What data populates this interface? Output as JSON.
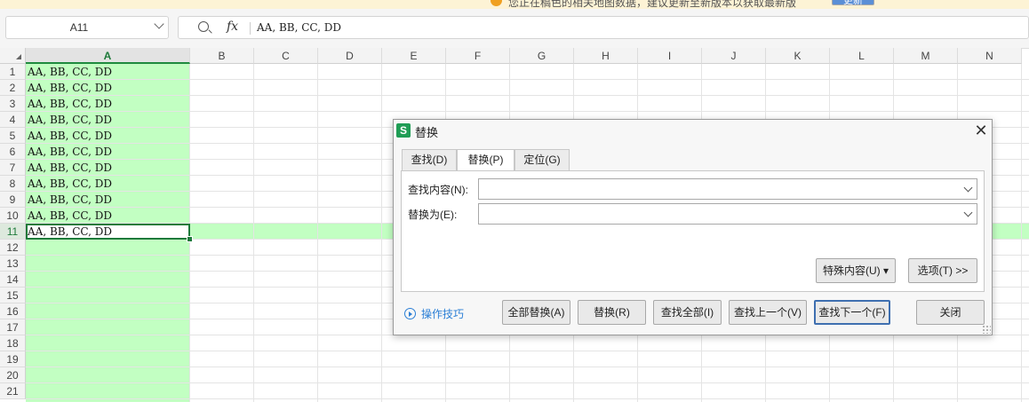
{
  "notice": {
    "text": "您正在稿色的相关地图数据，建议更新至新版本以获取最新版",
    "button": "更新"
  },
  "formula_bar": {
    "name_box": "A11",
    "fx_symbol": "fx",
    "content": "AA, BB, CC, DD"
  },
  "grid": {
    "columns": [
      "A",
      "B",
      "C",
      "D",
      "E",
      "F",
      "G",
      "H",
      "I",
      "J",
      "K",
      "L",
      "M",
      "N"
    ],
    "rows": [
      "1",
      "2",
      "3",
      "4",
      "5",
      "6",
      "7",
      "8",
      "9",
      "10",
      "11",
      "12",
      "13",
      "14",
      "15",
      "16",
      "17",
      "18",
      "19",
      "20",
      "21"
    ],
    "cells_A": [
      "AA, BB, CC, DD",
      "AA, BB, CC, DD",
      "AA, BB, CC, DD",
      "AA, BB, CC, DD",
      "AA, BB, CC, DD",
      "AA, BB, CC, DD",
      "AA, BB, CC, DD",
      "AA, BB, CC, DD",
      "AA, BB, CC, DD",
      "AA, BB, CC, DD",
      "AA, BB, CC, DD"
    ],
    "highlight_color": "#c2ffc2",
    "active_border_color": "#1e7a3a"
  },
  "dialog": {
    "logo": "S",
    "title": "替换",
    "close_glyph": "✕",
    "tabs": [
      "查找(D)",
      "替换(P)",
      "定位(G)"
    ],
    "active_tab": "替换(P)",
    "find_label": "查找内容(N):",
    "find_value": "",
    "replace_label": "替换为(E):",
    "replace_value": "",
    "special_button": "特殊内容(U) ▾",
    "options_button": "选项(T) >>",
    "tips_link": "操作技巧",
    "buttons": {
      "replace_all": "全部替换(A)",
      "replace": "替换(R)",
      "find_all": "查找全部(I)",
      "find_prev": "查找上一个(V)",
      "find_next": "查找下一个(F)",
      "close": "关闭"
    }
  }
}
